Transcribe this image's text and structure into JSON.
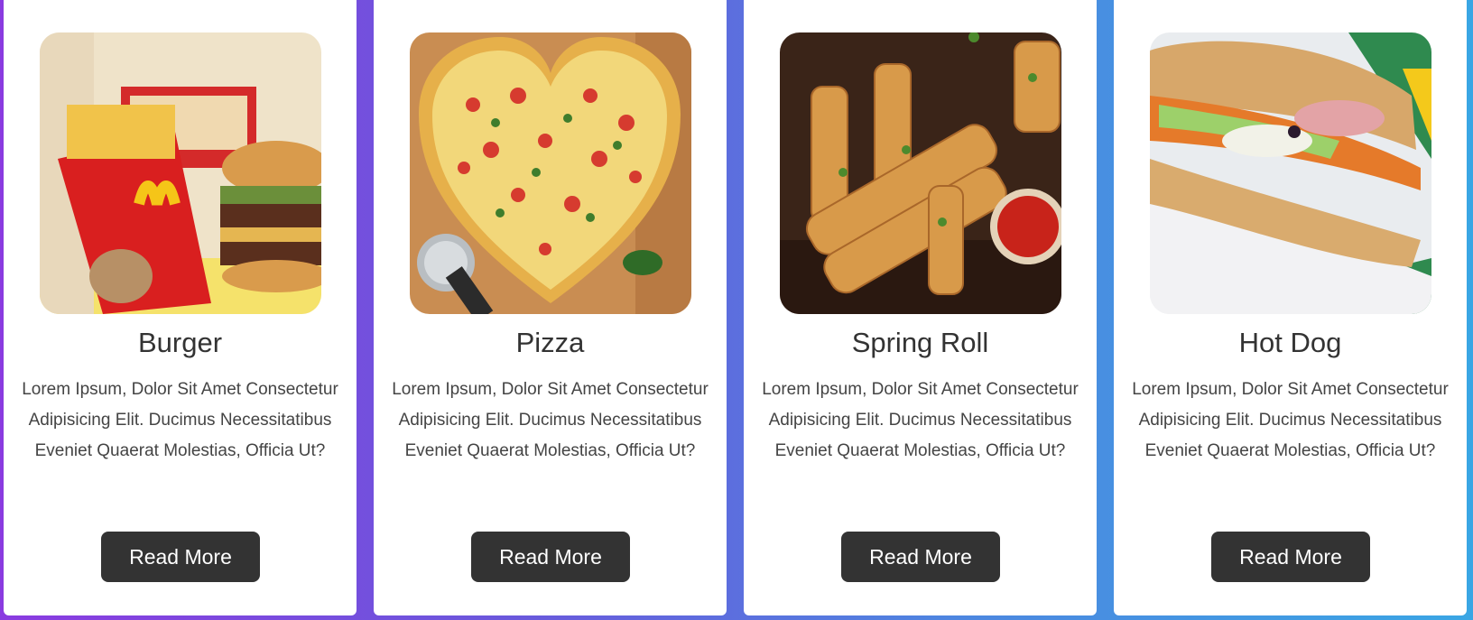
{
  "cards": [
    {
      "image": "burger-fries-image",
      "title": "Burger",
      "description": "Lorem Ipsum, Dolor Sit Amet Consectetur Adipisicing Elit. Ducimus Necessitatibus Eveniet Quaerat Molestias, Officia Ut?",
      "button_label": "Read More"
    },
    {
      "image": "heart-pizza-image",
      "title": "Pizza",
      "description": "Lorem Ipsum, Dolor Sit Amet Consectetur Adipisicing Elit. Ducimus Necessitatibus Eveniet Quaerat Molestias, Officia Ut?",
      "button_label": "Read More"
    },
    {
      "image": "spring-rolls-image",
      "title": "Spring Roll",
      "description": "Lorem Ipsum, Dolor Sit Amet Consectetur Adipisicing Elit. Ducimus Necessitatibus Eveniet Quaerat Molestias, Officia Ut?",
      "button_label": "Read More"
    },
    {
      "image": "sub-sandwich-image",
      "title": "Hot Dog",
      "description": "Lorem Ipsum, Dolor Sit Amet Consectetur Adipisicing Elit. Ducimus Necessitatibus Eveniet Quaerat Molestias, Officia Ut?",
      "button_label": "Read More"
    }
  ],
  "colors": {
    "background_gradient": [
      "#8a3be0",
      "#3aa6e4"
    ],
    "card": "#ffffff",
    "button": "#333333",
    "button_text": "#ffffff",
    "title": "#333333"
  }
}
